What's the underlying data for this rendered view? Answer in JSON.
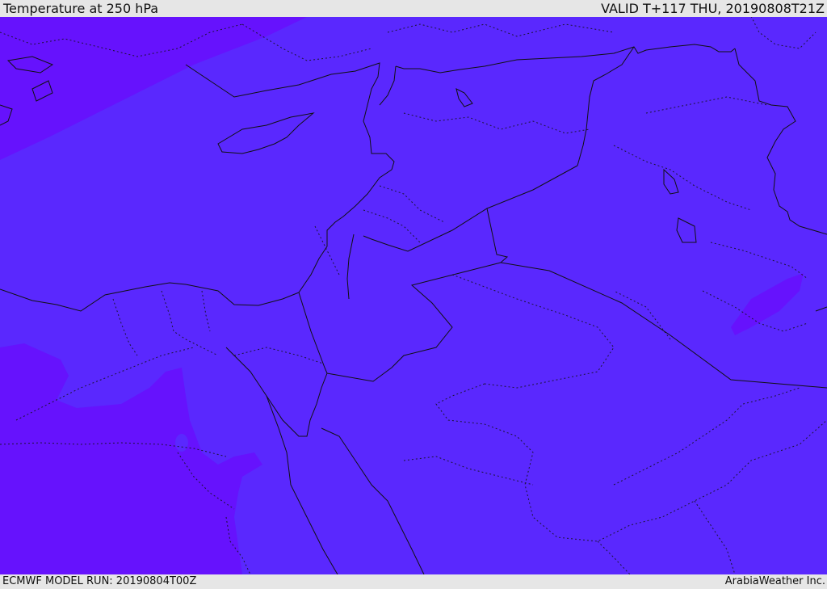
{
  "header": {
    "title": "Temperature at 250 hPa",
    "valid_time": "VALID T+117 THU, 20190808T21Z"
  },
  "footer": {
    "model_run": "ECMWF MODEL RUN: 20190804T00Z",
    "credit": "ArabiaWeather Inc."
  },
  "map": {
    "fill_colors": {
      "dominant": "#5a28fe",
      "cooler_band": "#6612fd",
      "borders": "#111111"
    }
  }
}
